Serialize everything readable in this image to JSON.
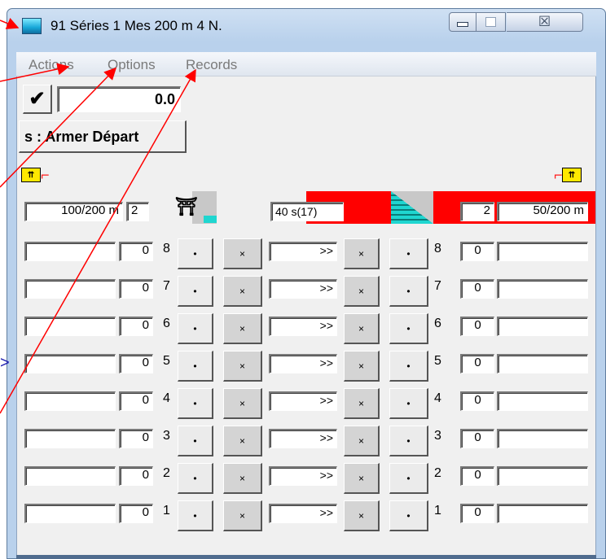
{
  "window": {
    "title": "91 Séries 1  Mes 200 m 4 N.",
    "minimize_icon": "minimize-icon",
    "maximize_icon": "maximize-icon",
    "close_icon": "close-icon",
    "close_glyph": "☒"
  },
  "menu": [
    "Actions",
    "Options",
    "Records"
  ],
  "toolbar": {
    "check_glyph": "✔",
    "time_value": "0.0",
    "arm_button": "s : Armer Départ"
  },
  "header_row": {
    "left_distance": "100/200  m",
    "left_count": "2",
    "timer": "40 s(17)",
    "right_count": "2",
    "right_distance": "50/200  m"
  },
  "lanes": [
    {
      "left_value": "0",
      "left_lane": "8",
      "dot": "•",
      "x": "×",
      "arrows": ">>",
      "x2": "×",
      "dot2": "•",
      "right_lane": "8",
      "right_value": "0"
    },
    {
      "left_value": "0",
      "left_lane": "7",
      "dot": "•",
      "x": "×",
      "arrows": ">>",
      "x2": "×",
      "dot2": "•",
      "right_lane": "7",
      "right_value": "0"
    },
    {
      "left_value": "0",
      "left_lane": "6",
      "dot": "•",
      "x": "×",
      "arrows": ">>",
      "x2": "×",
      "dot2": "•",
      "right_lane": "6",
      "right_value": "0"
    },
    {
      "left_value": "0",
      "left_lane": "5",
      "dot": "•",
      "x": "×",
      "arrows": ">>",
      "x2": "×",
      "dot2": "•",
      "right_lane": "5",
      "right_value": "0"
    },
    {
      "left_value": "0",
      "left_lane": "4",
      "dot": "•",
      "x": "×",
      "arrows": ">>",
      "x2": "×",
      "dot2": "•",
      "right_lane": "4",
      "right_value": "0"
    },
    {
      "left_value": "0",
      "left_lane": "3",
      "dot": "•",
      "x": "×",
      "arrows": ">>",
      "x2": "×",
      "dot2": "•",
      "right_lane": "3",
      "right_value": "0"
    },
    {
      "left_value": "0",
      "left_lane": "2",
      "dot": "•",
      "x": "×",
      "arrows": ">>",
      "x2": "×",
      "dot2": "•",
      "right_lane": "2",
      "right_value": "0"
    },
    {
      "left_value": "0",
      "left_lane": "1",
      "dot": "•",
      "x": "×",
      "arrows": ">>",
      "x2": "×",
      "dot2": "•",
      "right_lane": "1",
      "right_value": "0"
    }
  ],
  "icons": {
    "corner_left": "start-signal-icon",
    "corner_right": "start-signal-icon",
    "podium": "starting-block-icon"
  },
  "colors": {
    "red_band": "#ff0000",
    "annotation_arrows": "#ff0000",
    "title_icon": "#18a7d8"
  },
  "annotation": {
    "left_edge_glyph": ">"
  }
}
